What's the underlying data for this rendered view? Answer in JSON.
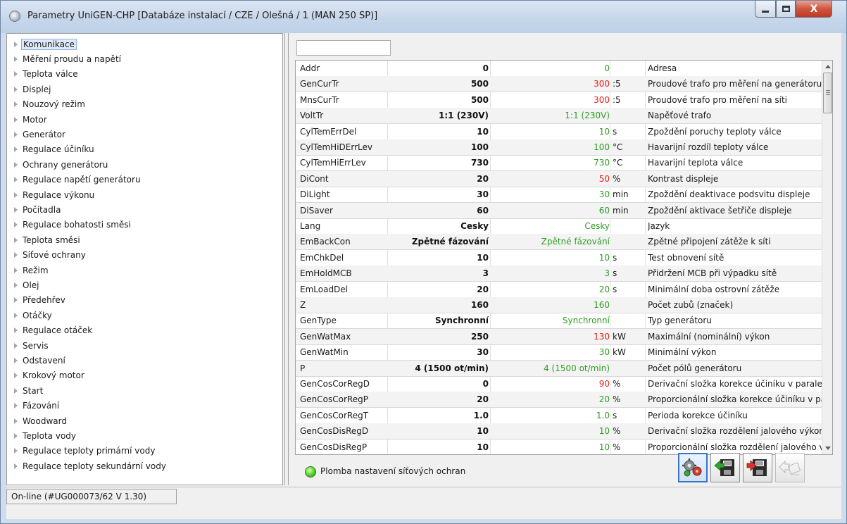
{
  "window": {
    "title": "Parametry UniGEN-CHP [Databáze instalací / CZE / Olešná / 1 (MAN 250 SP)]",
    "close_label": "X"
  },
  "tree": {
    "items": [
      {
        "label": "Komunikace",
        "selected": true
      },
      {
        "label": "Měření proudu a napětí"
      },
      {
        "label": "Teplota válce"
      },
      {
        "label": "Displej"
      },
      {
        "label": "Nouzový režim"
      },
      {
        "label": "Motor"
      },
      {
        "label": "Generátor"
      },
      {
        "label": "Regulace účiníku"
      },
      {
        "label": "Ochrany generátoru"
      },
      {
        "label": "Regulace napětí generátoru"
      },
      {
        "label": "Regulace výkonu"
      },
      {
        "label": "Počítadla"
      },
      {
        "label": "Regulace bohatosti směsi"
      },
      {
        "label": "Teplota směsi"
      },
      {
        "label": "Síťové ochrany"
      },
      {
        "label": "Režim"
      },
      {
        "label": "Olej"
      },
      {
        "label": "Předehřev"
      },
      {
        "label": "Otáčky"
      },
      {
        "label": "Regulace otáček"
      },
      {
        "label": "Servis"
      },
      {
        "label": "Odstavení"
      },
      {
        "label": "Krokový motor"
      },
      {
        "label": "Start"
      },
      {
        "label": "Fázování"
      },
      {
        "label": "Woodward"
      },
      {
        "label": "Teplota vody"
      },
      {
        "label": "Regulace teploty primární vody"
      },
      {
        "label": "Regulace teploty sekundární vody"
      }
    ]
  },
  "filter": {
    "value": ""
  },
  "colors": {
    "default_equal": "#2e9e1f",
    "default_changed": "#e0241b"
  },
  "grid": {
    "rows": [
      {
        "name": "Addr",
        "current": "0",
        "default": "0",
        "unit": "",
        "desc": "Adresa",
        "changed": false
      },
      {
        "name": "GenCurTr",
        "current": "500",
        "default": "300",
        "unit": ":5",
        "desc": "Proudové trafo pro měření na generátoru",
        "changed": true
      },
      {
        "name": "MnsCurTr",
        "current": "500",
        "default": "300",
        "unit": ":5",
        "desc": "Proudové trafo pro měření na síti",
        "changed": true
      },
      {
        "name": "VoltTr",
        "current": "1:1 (230V)",
        "default": "1:1 (230V)",
        "unit": "",
        "desc": "Napěťové trafo",
        "changed": false
      },
      {
        "name": "CylTemErrDel",
        "current": "10",
        "default": "10",
        "unit": "s",
        "desc": "Zpoždění poruchy teploty válce",
        "changed": false
      },
      {
        "name": "CylTemHiDErrLev",
        "current": "100",
        "default": "100",
        "unit": "°C",
        "desc": "Havarijní rozdíl teploty válce",
        "changed": false
      },
      {
        "name": "CylTemHiErrLev",
        "current": "730",
        "default": "730",
        "unit": "°C",
        "desc": "Havarijní teplota válce",
        "changed": false
      },
      {
        "name": "DiCont",
        "current": "20",
        "default": "50",
        "unit": "%",
        "desc": "Kontrast displeje",
        "changed": true
      },
      {
        "name": "DiLight",
        "current": "30",
        "default": "30",
        "unit": "min",
        "desc": "Zpoždění deaktivace podsvitu displeje",
        "changed": false
      },
      {
        "name": "DiSaver",
        "current": "60",
        "default": "60",
        "unit": "min",
        "desc": "Zpoždění aktivace šetřiče displeje",
        "changed": false
      },
      {
        "name": "Lang",
        "current": "Cesky",
        "default": "Cesky",
        "unit": "",
        "desc": "Jazyk",
        "changed": false
      },
      {
        "name": "EmBackCon",
        "current": "Zpětné fázování",
        "default": "Zpětné fázování",
        "unit": "",
        "desc": "Zpětné připojení zátěže k síti",
        "changed": false
      },
      {
        "name": "EmChkDel",
        "current": "10",
        "default": "10",
        "unit": "s",
        "desc": "Test obnovení sítě",
        "changed": false
      },
      {
        "name": "EmHoldMCB",
        "current": "3",
        "default": "3",
        "unit": "s",
        "desc": "Přidržení MCB při výpadku sítě",
        "changed": false
      },
      {
        "name": "EmLoadDel",
        "current": "20",
        "default": "20",
        "unit": "s",
        "desc": "Minimální doba ostrovní zátěže",
        "changed": false
      },
      {
        "name": "Z",
        "current": "160",
        "default": "160",
        "unit": "",
        "desc": "Počet zubů (značek)",
        "changed": false
      },
      {
        "name": "GenType",
        "current": "Synchronní",
        "default": "Synchronní",
        "unit": "",
        "desc": "Typ generátoru",
        "changed": false
      },
      {
        "name": "GenWatMax",
        "current": "250",
        "default": "130",
        "unit": "kW",
        "desc": "Maximální (nominální) výkon",
        "changed": true
      },
      {
        "name": "GenWatMin",
        "current": "30",
        "default": "30",
        "unit": "kW",
        "desc": "Minimální výkon",
        "changed": false
      },
      {
        "name": "P",
        "current": "4 (1500 ot/min)",
        "default": "4 (1500 ot/min)",
        "unit": "",
        "desc": "Počet pólů generátoru",
        "changed": false
      },
      {
        "name": "GenCosCorRegD",
        "current": "0",
        "default": "90",
        "unit": "%",
        "desc": "Derivační složka korekce účiníku v paralelním chodu",
        "changed": true
      },
      {
        "name": "GenCosCorRegP",
        "current": "20",
        "default": "20",
        "unit": "%",
        "desc": "Proporcionální složka korekce účiníku v paralelním chodu",
        "changed": false
      },
      {
        "name": "GenCosCorRegT",
        "current": "1.0",
        "default": "1.0",
        "unit": "s",
        "desc": "Perioda korekce účiníku",
        "changed": false
      },
      {
        "name": "GenCosDisRegD",
        "current": "10",
        "default": "10",
        "unit": "%",
        "desc": "Derivační složka rozdělení jalového výkonu",
        "changed": false
      },
      {
        "name": "GenCosDisRegP",
        "current": "10",
        "default": "10",
        "unit": "%",
        "desc": "Proporcionální složka rozdělení jalového výkonu",
        "changed": false
      }
    ]
  },
  "seal": {
    "label": "Plomba nastavení síťových ochran",
    "icon": "green-led-icon"
  },
  "toolbar": {
    "buttons": [
      {
        "name": "settings-button",
        "icon": "gears-icon"
      },
      {
        "name": "load-from-disk-button",
        "icon": "floppy-load-icon"
      },
      {
        "name": "save-to-disk-button",
        "icon": "floppy-save-icon"
      },
      {
        "name": "write-to-device-button",
        "icon": "chip-write-icon",
        "disabled": true
      }
    ]
  },
  "status": {
    "text": "On-line (#UG000073/62  V 1.30)"
  }
}
